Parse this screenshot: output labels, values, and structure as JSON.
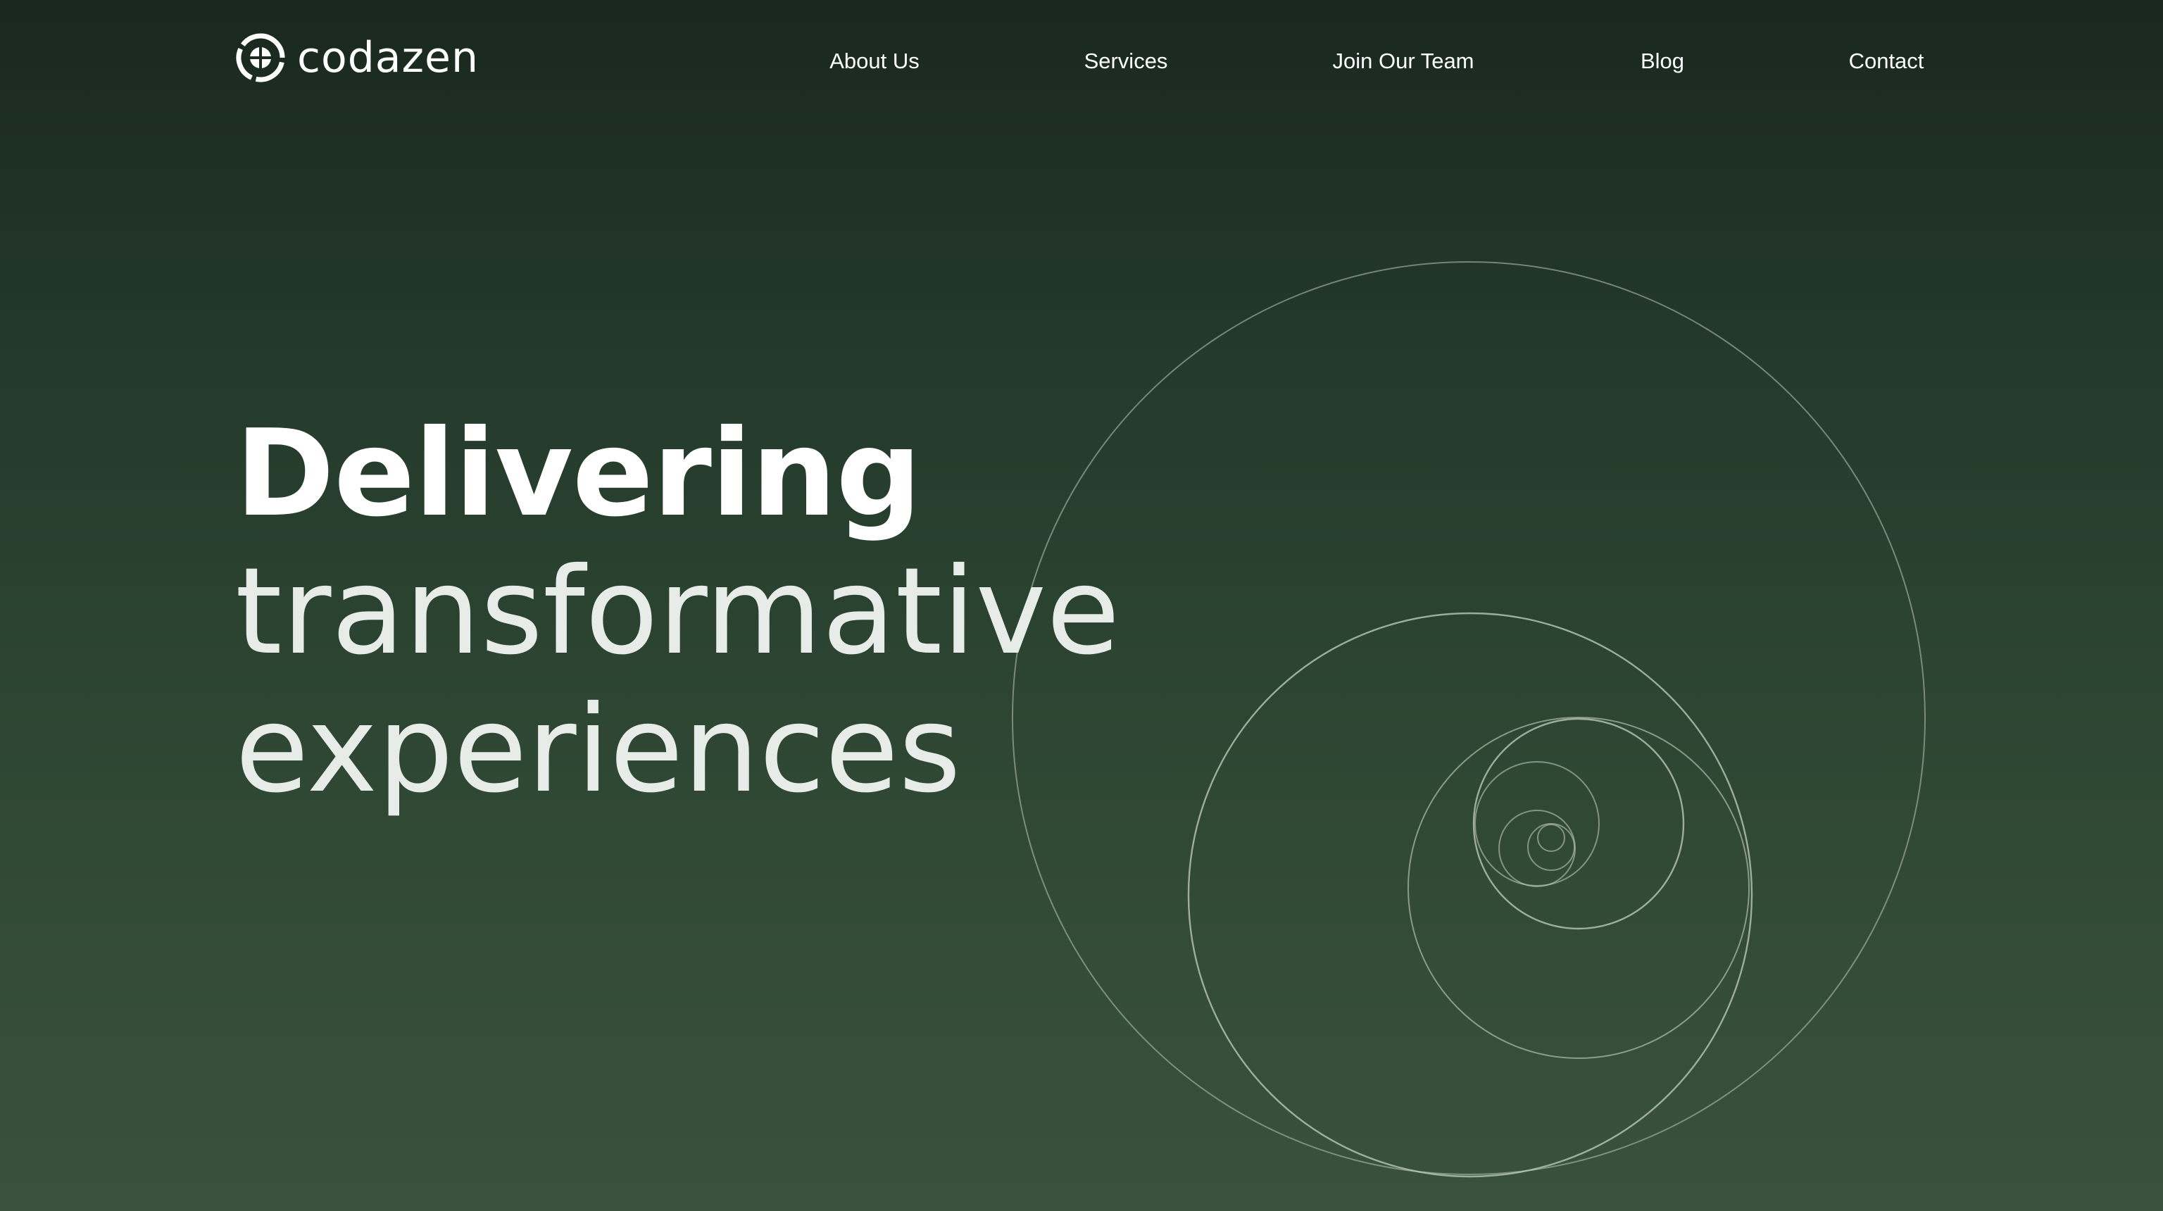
{
  "brand": {
    "name": "codazen",
    "logo_icon": "codazen-logo-icon"
  },
  "nav": {
    "items": [
      {
        "label": "About Us"
      },
      {
        "label": "Services"
      },
      {
        "label": "Join Our Team"
      },
      {
        "label": "Blog"
      },
      {
        "label": "Contact"
      }
    ]
  },
  "hero": {
    "line1": "Delivering",
    "line2": "transformative",
    "line3": "experiences"
  },
  "colors": {
    "background_top": "#1a281f",
    "background_bottom": "#3a523d",
    "text": "#ffffff",
    "circle_stroke": "#b9c7b6"
  }
}
